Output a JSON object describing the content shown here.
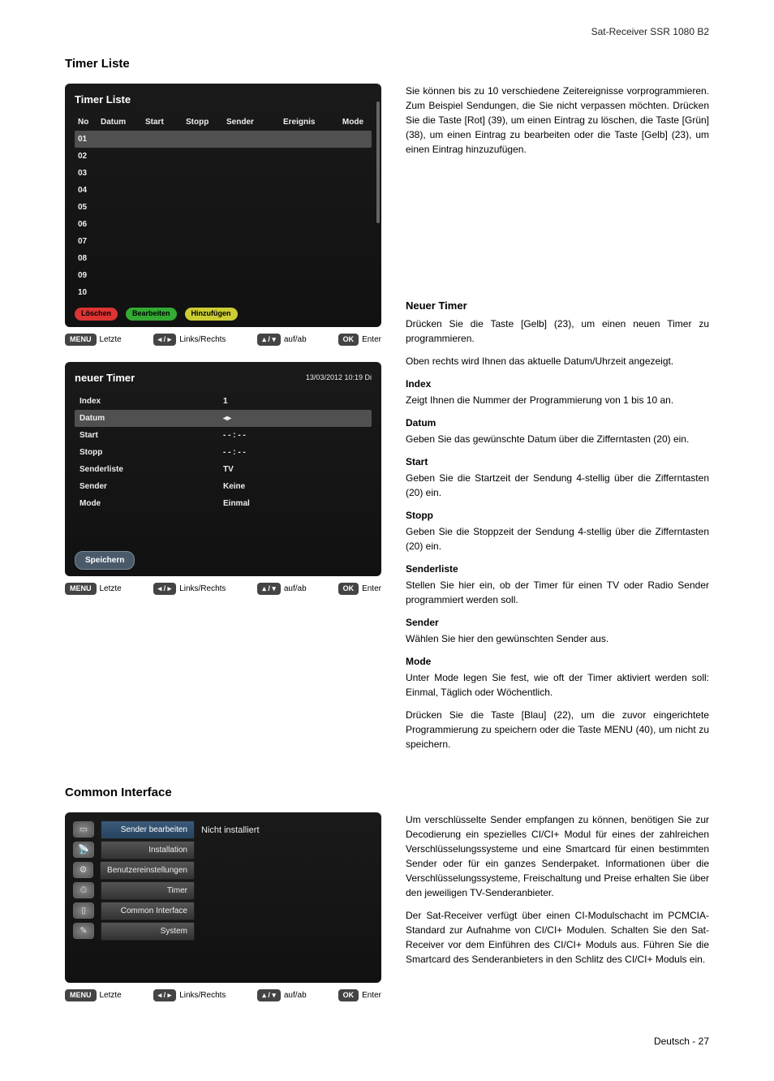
{
  "header": {
    "product": "Sat-Receiver SSR 1080 B2"
  },
  "sections": {
    "timerListe": {
      "title": "Timer Liste"
    },
    "commonInterface": {
      "title": "Common Interface"
    }
  },
  "timerPanel": {
    "title": "Timer Liste",
    "headers": {
      "no": "No",
      "datum": "Datum",
      "start": "Start",
      "stopp": "Stopp",
      "sender": "Sender",
      "ereignis": "Ereignis",
      "mode": "Mode"
    },
    "rows": [
      "01",
      "02",
      "03",
      "04",
      "05",
      "06",
      "07",
      "08",
      "09",
      "10"
    ],
    "buttons": {
      "loeschen": "Löschen",
      "bearbeiten": "Bearbeiten",
      "hinzufuegen": "Hinzufügen"
    },
    "nav": {
      "menu": "MENU",
      "letzte": "Letzte",
      "lr": "Links/Rechts",
      "ud": "auf/ab",
      "ok": "OK",
      "enter": "Enter",
      "arrows_lr": "◂ / ▸",
      "arrows_ud": "▴ / ▾"
    }
  },
  "neuerTimerPanel": {
    "title": "neuer Timer",
    "datetime": "13/03/2012 10:19 Di",
    "fields": {
      "index": {
        "label": "Index",
        "value": "1"
      },
      "datum": {
        "label": "Datum",
        "value": "◂▸"
      },
      "start": {
        "label": "Start",
        "value": "- - : - -"
      },
      "stopp": {
        "label": "Stopp",
        "value": "- - : - -"
      },
      "senderliste": {
        "label": "Senderliste",
        "value": "TV"
      },
      "sender": {
        "label": "Sender",
        "value": "Keine"
      },
      "mode": {
        "label": "Mode",
        "value": "Einmal"
      }
    },
    "save": "Speichern"
  },
  "ciPanel": {
    "items": [
      {
        "icon": "▭",
        "label": "Sender bearbeiten",
        "sel": true
      },
      {
        "icon": "📡",
        "label": "Installation",
        "sel": false
      },
      {
        "icon": "⚙",
        "label": "Benutzereinstellungen",
        "sel": false
      },
      {
        "icon": "⏱",
        "label": "Timer",
        "sel": false
      },
      {
        "icon": "▯",
        "label": "Common Interface",
        "sel": false
      },
      {
        "icon": "✎",
        "label": "System",
        "sel": false
      }
    ],
    "right": "Nicht installiert"
  },
  "textRight": {
    "timerListeP1": "Sie können bis zu 10 verschiedene Zeitereignisse vorprogrammieren. Zum Beispiel Sendungen, die Sie nicht verpassen möchten. Drücken Sie die Taste [Rot] (39), um einen Eintrag zu löschen, die Taste [Grün] (38), um einen Eintrag zu bearbeiten oder die Taste [Gelb] (23), um einen Eintrag hinzuzufügen.",
    "neuerTimerTitle": "Neuer Timer",
    "neuerTimerP1": "Drücken Sie die Taste [Gelb] (23), um einen neuen Timer zu programmieren.",
    "neuerTimerP2": "Oben rechts wird Ihnen das aktuelle Datum/Uhrzeit angezeigt.",
    "indexTitle": "Index",
    "indexP": "Zeigt Ihnen die Nummer der Programmierung von 1 bis 10 an.",
    "datumTitle": "Datum",
    "datumP": "Geben Sie das gewünschte Datum über die Zifferntasten (20) ein.",
    "startTitle": "Start",
    "startP": "Geben Sie die Startzeit der Sendung 4-stellig über die Zifferntasten (20) ein.",
    "stoppTitle": "Stopp",
    "stoppP": "Geben Sie die Stoppzeit der Sendung 4-stellig über die Zifferntasten (20) ein.",
    "senderlisteTitle": "Senderliste",
    "senderlisteP": "Stellen Sie hier ein, ob der Timer für einen TV oder Radio Sender programmiert werden soll.",
    "senderTitle": "Sender",
    "senderP": "Wählen Sie hier den gewünschten Sender aus.",
    "modeTitle": "Mode",
    "modeP": "Unter Mode legen Sie fest, wie oft der Timer aktiviert werden soll: Einmal, Täglich oder Wöchentlich.",
    "saveP": "Drücken Sie die Taste [Blau] (22), um die zuvor eingerichtete Programmierung zu speichern oder die Taste MENU (40), um nicht zu speichern.",
    "ciP1": "Um verschlüsselte Sender empfangen zu können, benötigen Sie zur Decodierung ein spezielles CI/CI+ Modul für eines der zahlreichen Verschlüsselungssysteme und eine Smartcard für einen bestimmten Sender oder für ein ganzes Senderpaket. Informationen über die Verschlüsselungssysteme, Freischaltung und Preise erhalten Sie über den jeweiligen TV-Senderanbieter.",
    "ciP2": "Der Sat-Receiver verfügt über einen CI-Modulschacht im PCMCIA-Standard zur Aufnahme von CI/CI+ Modulen. Schalten Sie den Sat-Receiver vor dem Einführen des CI/CI+ Moduls aus. Führen Sie die Smartcard des Senderanbieters in den Schlitz des CI/CI+ Moduls ein."
  },
  "footer": {
    "lang": "Deutsch",
    "page": "27"
  }
}
